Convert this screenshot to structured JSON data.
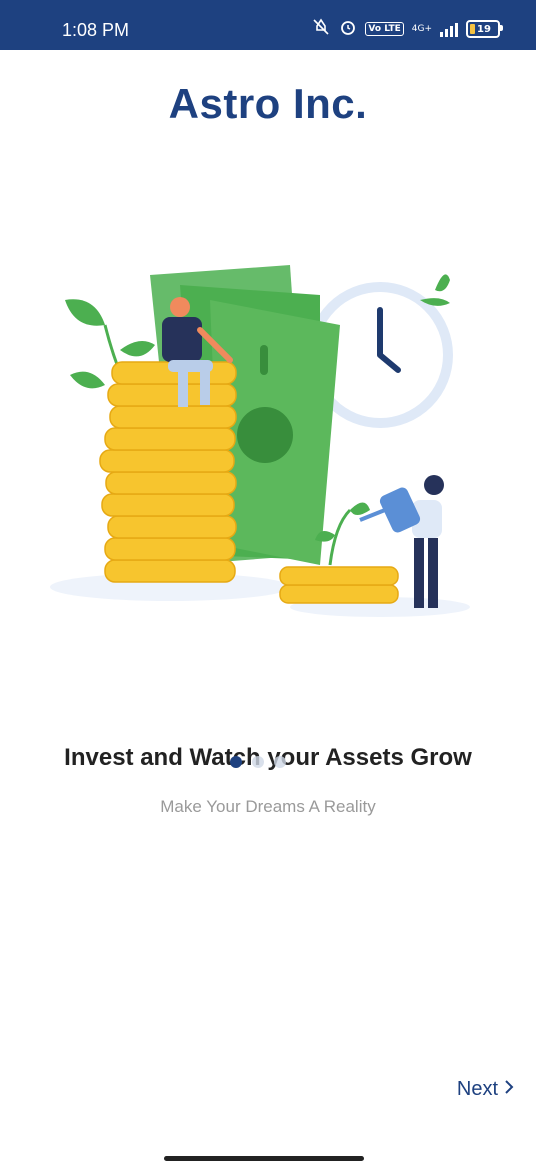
{
  "status": {
    "time": "1:08 PM",
    "network": "4G+",
    "volte": "Vo LTE",
    "battery": "19"
  },
  "brand": {
    "title": "Astro Inc."
  },
  "onboarding": {
    "headline": "Invest and Watch your Assets Grow",
    "subtitle": "Make Your Dreams A Reality",
    "pages": 3,
    "current_page": 1
  },
  "footer": {
    "next_label": "Next"
  },
  "colors": {
    "primary": "#1e4180",
    "money_green": "#4caf50",
    "coin_gold": "#f7c52e"
  }
}
